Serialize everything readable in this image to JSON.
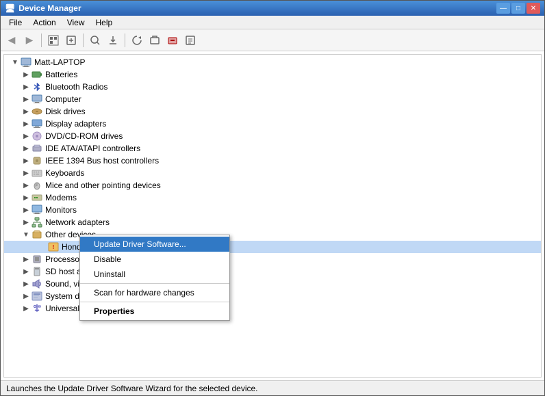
{
  "window": {
    "title": "Device Manager",
    "icon": "🖥"
  },
  "titlebar": {
    "title": "Device Manager",
    "minimize": "—",
    "maximize": "□",
    "close": "✕"
  },
  "menubar": {
    "items": [
      "File",
      "Action",
      "View",
      "Help"
    ]
  },
  "toolbar": {
    "buttons": [
      "◀",
      "▶",
      "🗔",
      "⬛",
      "🔍",
      "⬛",
      "⭯",
      "⛔",
      "⚠",
      "📋"
    ]
  },
  "tree": {
    "root": "Matt-LAPTOP",
    "items": [
      {
        "label": "Batteries",
        "indent": 1,
        "expanded": false,
        "icon": "🔋"
      },
      {
        "label": "Bluetooth Radios",
        "indent": 1,
        "expanded": false,
        "icon": "📡"
      },
      {
        "label": "Computer",
        "indent": 1,
        "expanded": false,
        "icon": "💻"
      },
      {
        "label": "Disk drives",
        "indent": 1,
        "expanded": false,
        "icon": "💾"
      },
      {
        "label": "Display adapters",
        "indent": 1,
        "expanded": false,
        "icon": "🖥"
      },
      {
        "label": "DVD/CD-ROM drives",
        "indent": 1,
        "expanded": false,
        "icon": "💿"
      },
      {
        "label": "IDE ATA/ATAPI controllers",
        "indent": 1,
        "expanded": false,
        "icon": "🔌"
      },
      {
        "label": "IEEE 1394 Bus host controllers",
        "indent": 1,
        "expanded": false,
        "icon": "🔌"
      },
      {
        "label": "Keyboards",
        "indent": 1,
        "expanded": false,
        "icon": "⌨"
      },
      {
        "label": "Mice and other pointing devices",
        "indent": 1,
        "expanded": false,
        "icon": "🖱"
      },
      {
        "label": "Modems",
        "indent": 1,
        "expanded": false,
        "icon": "📠"
      },
      {
        "label": "Monitors",
        "indent": 1,
        "expanded": false,
        "icon": "🖥"
      },
      {
        "label": "Network adapters",
        "indent": 1,
        "expanded": false,
        "icon": "🔌"
      },
      {
        "label": "Other devices",
        "indent": 1,
        "expanded": true,
        "icon": "🔧"
      },
      {
        "label": "Hondata FlashPro",
        "indent": 2,
        "expanded": false,
        "icon": "❗",
        "selected": true
      },
      {
        "label": "Processors",
        "indent": 1,
        "expanded": false,
        "icon": "⚙"
      },
      {
        "label": "SD host adapters",
        "indent": 1,
        "expanded": false,
        "icon": "💳"
      },
      {
        "label": "Sound, video and game controllers",
        "indent": 1,
        "expanded": false,
        "icon": "🔊"
      },
      {
        "label": "System devices",
        "indent": 1,
        "expanded": false,
        "icon": "⚙"
      },
      {
        "label": "Universal Serial Bus controllers",
        "indent": 1,
        "expanded": false,
        "icon": "🔌"
      }
    ]
  },
  "context_menu": {
    "items": [
      {
        "label": "Update Driver Software...",
        "highlighted": true,
        "bold": false
      },
      {
        "label": "Disable",
        "highlighted": false,
        "bold": false
      },
      {
        "label": "Uninstall",
        "highlighted": false,
        "bold": false
      },
      {
        "separator": true
      },
      {
        "label": "Scan for hardware changes",
        "highlighted": false,
        "bold": false
      },
      {
        "separator": true
      },
      {
        "label": "Properties",
        "highlighted": false,
        "bold": true
      }
    ]
  },
  "statusbar": {
    "text": "Launches the Update Driver Software Wizard for the selected device."
  }
}
